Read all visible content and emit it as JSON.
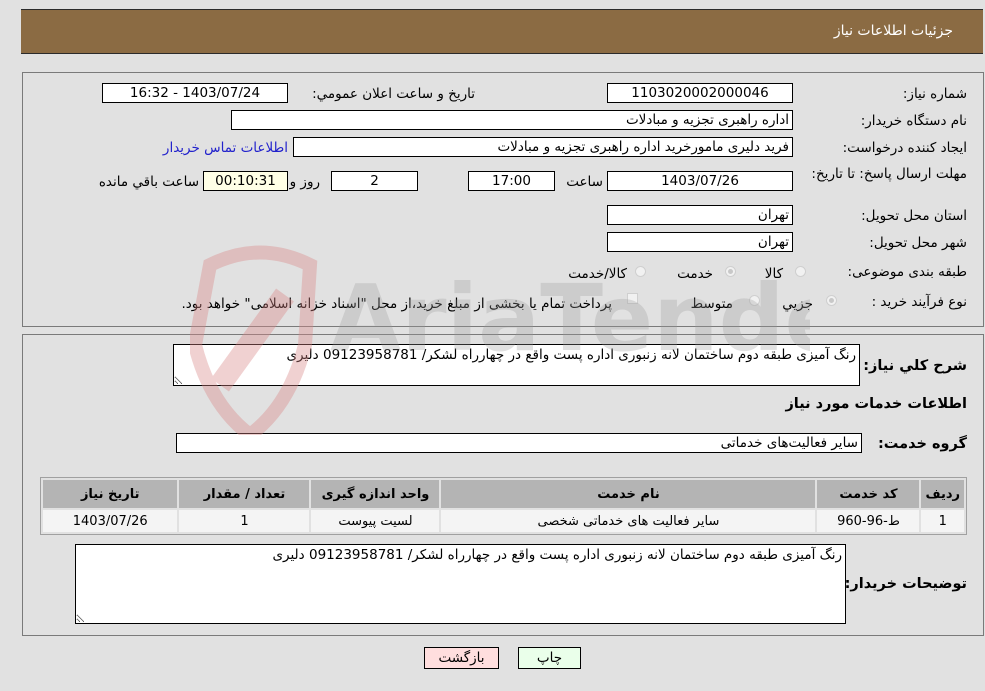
{
  "header": {
    "title": "جزئیات اطلاعات نیاز"
  },
  "form": {
    "need_number_label": "شماره نیاز:",
    "need_number": "1103020002000046",
    "announce_label": "تاریخ و ساعت اعلان عمومي:",
    "announce_value": "1403/07/24 - 16:32",
    "buyer_org_label": "نام دستگاه خریدار:",
    "buyer_org": "اداره راهبری تجزیه و مبادلات",
    "creator_label": "ایجاد کننده درخواست:",
    "creator": "فرید دلیری مامورخرید اداره راهبری تجزیه و مبادلات",
    "contact_link": "اطلاعات تماس خریدار",
    "deadline_label": "مهلت ارسال پاسخ: تا تاریخ:",
    "deadline_date": "1403/07/26",
    "time_label": "ساعت",
    "deadline_time": "17:00",
    "days_value": "2",
    "days_label": "روز و",
    "remaining_time": "00:10:31",
    "remaining_label": "ساعت باقي مانده",
    "province_label": "استان محل تحویل:",
    "province": "تهران",
    "city_label": "شهر محل تحویل:",
    "city": "تهران",
    "category_label": "طبقه بندی موضوعی:",
    "category_options": [
      {
        "label": "کالا",
        "checked": false
      },
      {
        "label": "خدمت",
        "checked": true
      },
      {
        "label": "کالا/خدمت",
        "checked": false
      }
    ],
    "process_label": "نوع فرآیند خرید :",
    "process_options": [
      {
        "label": "جزيي",
        "checked": true
      },
      {
        "label": "متوسط",
        "checked": false
      }
    ],
    "treasury_note": "پرداخت تمام یا بخشی از مبلغ خرید،از محل \"اسناد خزانه اسلامی\" خواهد بود."
  },
  "description": {
    "label": "شرح کلي نياز:",
    "value": "رنگ آمیزی طبقه دوم ساختمان لانه زنبوری اداره پست واقع در چهارراه لشکر/ 09123958781 دلیری"
  },
  "services": {
    "section_title": "اطلاعات خدمات مورد نياز",
    "group_label": "گروه خدمت:",
    "group_value": "سایر فعالیت‌های خدماتی",
    "columns": [
      "ردیف",
      "کد خدمت",
      "نام خدمت",
      "واحد اندازه گیری",
      "تعداد / مقدار",
      "تاریخ نیاز"
    ],
    "rows": [
      [
        "1",
        "ط-96-960",
        "سایر فعالیت های خدماتی شخصی",
        "لسیت پیوست",
        "1",
        "1403/07/26"
      ]
    ]
  },
  "buyer_notes": {
    "label": "توضیحات خریدار:",
    "value": "رنگ آمیزی طبقه دوم ساختمان لانه زنبوری اداره پست واقع در چهارراه لشکر/ 09123958781 دلیری"
  },
  "buttons": {
    "print": "چاپ",
    "back": "بازگشت"
  },
  "watermark": {
    "text": "AriaTender.neT"
  },
  "colors": {
    "header": "#8b6b43",
    "print_bg": "#eaffea",
    "back_bg": "#ffdede",
    "link": "#2222cc"
  }
}
